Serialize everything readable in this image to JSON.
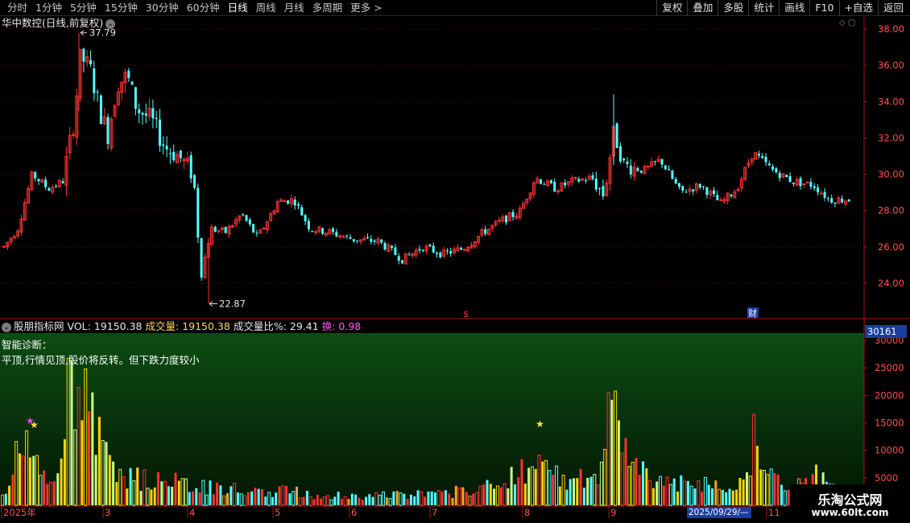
{
  "toolbar": {
    "periods": [
      "分时",
      "1分钟",
      "5分钟",
      "15分钟",
      "30分钟",
      "60分钟",
      "日线",
      "周线",
      "月线",
      "多周期",
      "更多 >"
    ],
    "active_period": "日线",
    "actions": [
      "复权",
      "叠加",
      "多股",
      "统计",
      "画线",
      "F10",
      "+自选",
      "返回"
    ]
  },
  "price_chart": {
    "title": "华中数控(日线,前复权)",
    "high_label": "37.79",
    "low_label": "22.87",
    "y_ticks": [
      "38.00",
      "36.00",
      "34.00",
      "32.00",
      "30.00",
      "28.00",
      "26.00",
      "24.00"
    ],
    "markers": [
      "$",
      "财"
    ]
  },
  "indicator": {
    "name": "股朋指标网",
    "vol_label": "VOL:",
    "vol_value": "19150.38",
    "cjl_label": "成交量:",
    "cjl_value": "19150.38",
    "ratio_label": "成交量比%:",
    "ratio_value": "29.41",
    "turnover_label": "换:",
    "turnover_value": "0.98",
    "diagnosis_title": "智能诊断：",
    "diagnosis_text": "平顶,行情见顶,股价将反转。但下跌力度较小",
    "y_ticks": [
      "30000",
      "25000",
      "20000",
      "15000",
      "10000",
      "5000"
    ],
    "axis_value": "30161"
  },
  "time_axis": {
    "labels": [
      "2025年",
      "3",
      "4",
      "5",
      "6",
      "7",
      "8",
      "9",
      "11"
    ],
    "highlight_date": "2025/09/29/—"
  },
  "watermark": {
    "title": "乐淘公式网",
    "url": "www.60lt.com"
  },
  "colors": {
    "up": "#ff3232",
    "down": "#54ffff",
    "volume_yellow": "#ffd700",
    "volume_light": "#c8ff8a",
    "axis_red": "#a01818",
    "indicator_bg_top": "#0b4a12",
    "indicator_bg_bottom": "#041a05"
  }
}
